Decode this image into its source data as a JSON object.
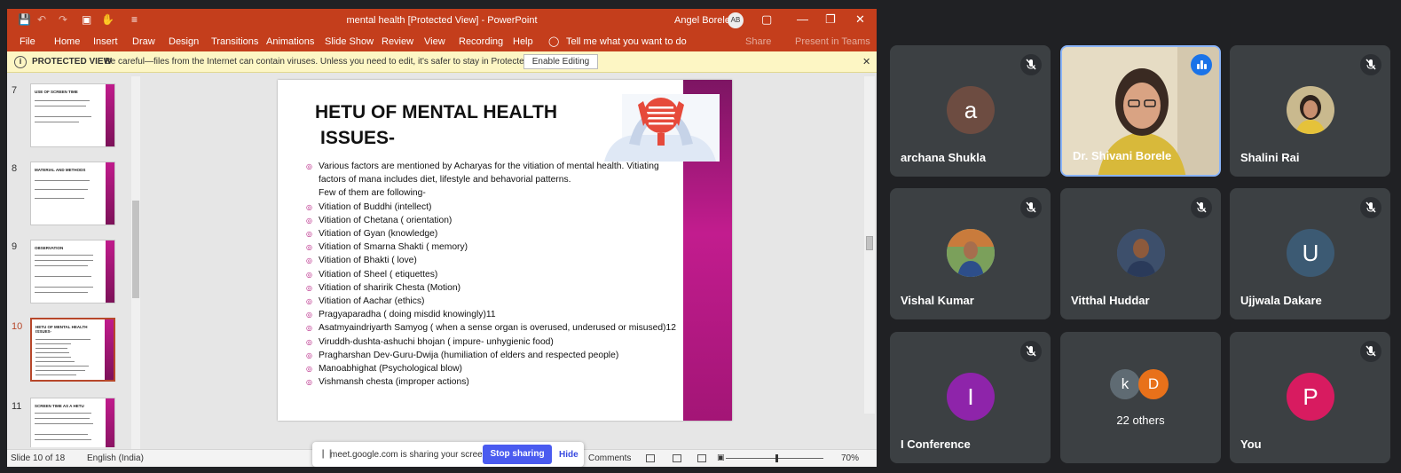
{
  "ppt": {
    "title": "mental health [Protected View]  -  PowerPoint",
    "user_name": "Angel Borele",
    "user_initials": "AB",
    "tabs": [
      "File",
      "Home",
      "Insert",
      "Draw",
      "Design",
      "Transitions",
      "Animations",
      "Slide Show",
      "Review",
      "View",
      "Recording",
      "Help"
    ],
    "tell_me": "Tell me what you want to do",
    "share_label": "Share",
    "teams_label": "Present in Teams",
    "protected": {
      "label": "PROTECTED VIEW",
      "message": "Be careful—files from the Internet can contain viruses. Unless you need to edit, it's safer to stay in Protected View.",
      "button": "Enable Editing"
    },
    "thumbnails": [
      {
        "num": "7",
        "title": "USE OF SCREEN TIME"
      },
      {
        "num": "8",
        "title": "MATERIAL AND METHODS"
      },
      {
        "num": "9",
        "title": "OBSERVATION"
      },
      {
        "num": "10",
        "title": "HETU OF MENTAL HEALTH ISSUES-"
      },
      {
        "num": "11",
        "title": "SCREEN TIME AS A HETU"
      }
    ],
    "slide": {
      "title_line1": "HETU OF MENTAL HEALTH",
      "title_line2": "ISSUES-",
      "bullets": [
        "Various factors are mentioned by Acharyas for the vitiation of mental health. Vitiating factors of mana includes diet, lifestyle and behavorial patterns.",
        "Few of them are following-",
        "Vitiation of Buddhi (intellect)",
        "Vitiation of Chetana ( orientation)",
        "Vitiation of Gyan (knowledge)",
        "Vitiation of Smarna Shakti ( memory)",
        "Vitiation of Bhakti ( love)",
        "Vitiation of Sheel ( etiquettes)",
        "Vitiation of sharirik Chesta (Motion)",
        "Vitiation of Aachar (ethics)",
        "Pragyaparadha ( doing misdid knowingly)11",
        "Asatmyaindriyarth Samyog ( when a sense organ is overused, underused or misused)12",
        "Viruddh-dushta-ashuchi bhojan ( impure- unhygienic food)",
        "Pragharshan Dev-Guru-Dwija (humiliation of elders and respected people)",
        "Manoabhighat (Psychological blow)",
        "Vishmansh chesta (improper actions)"
      ]
    },
    "status": {
      "slide": "Slide 10 of 18",
      "language": "English (India)",
      "comments": "Comments",
      "zoom": "70%"
    }
  },
  "sharebar": {
    "text": "meet.google.com is sharing your screen.",
    "stop": "Stop sharing",
    "hide": "Hide"
  },
  "meet": {
    "tiles": [
      {
        "name": "archana Shukla",
        "initial": "a",
        "color": "#6d4c41"
      },
      {
        "name": "Dr. Shivani Borele"
      },
      {
        "name": "Shalini Rai"
      },
      {
        "name": "Vishal Kumar"
      },
      {
        "name": "Vitthal Huddar"
      },
      {
        "name": "Ujjwala Dakare",
        "initial": "U",
        "color": "#3c5a73"
      },
      {
        "name": "I Conference",
        "initial": "I",
        "color": "#8e24aa"
      },
      {
        "name": "22 others",
        "initials": [
          "k",
          "D"
        ],
        "colors": [
          "#5f6b73",
          "#e8711a"
        ]
      },
      {
        "name": "You",
        "initial": "P",
        "color": "#d81b60"
      }
    ]
  },
  "colors": {
    "ppt_accent": "#c43e1c",
    "slide_bar": "#c21c8e",
    "meet_tile": "#3c4043",
    "stop_button": "#4a5bf0"
  }
}
